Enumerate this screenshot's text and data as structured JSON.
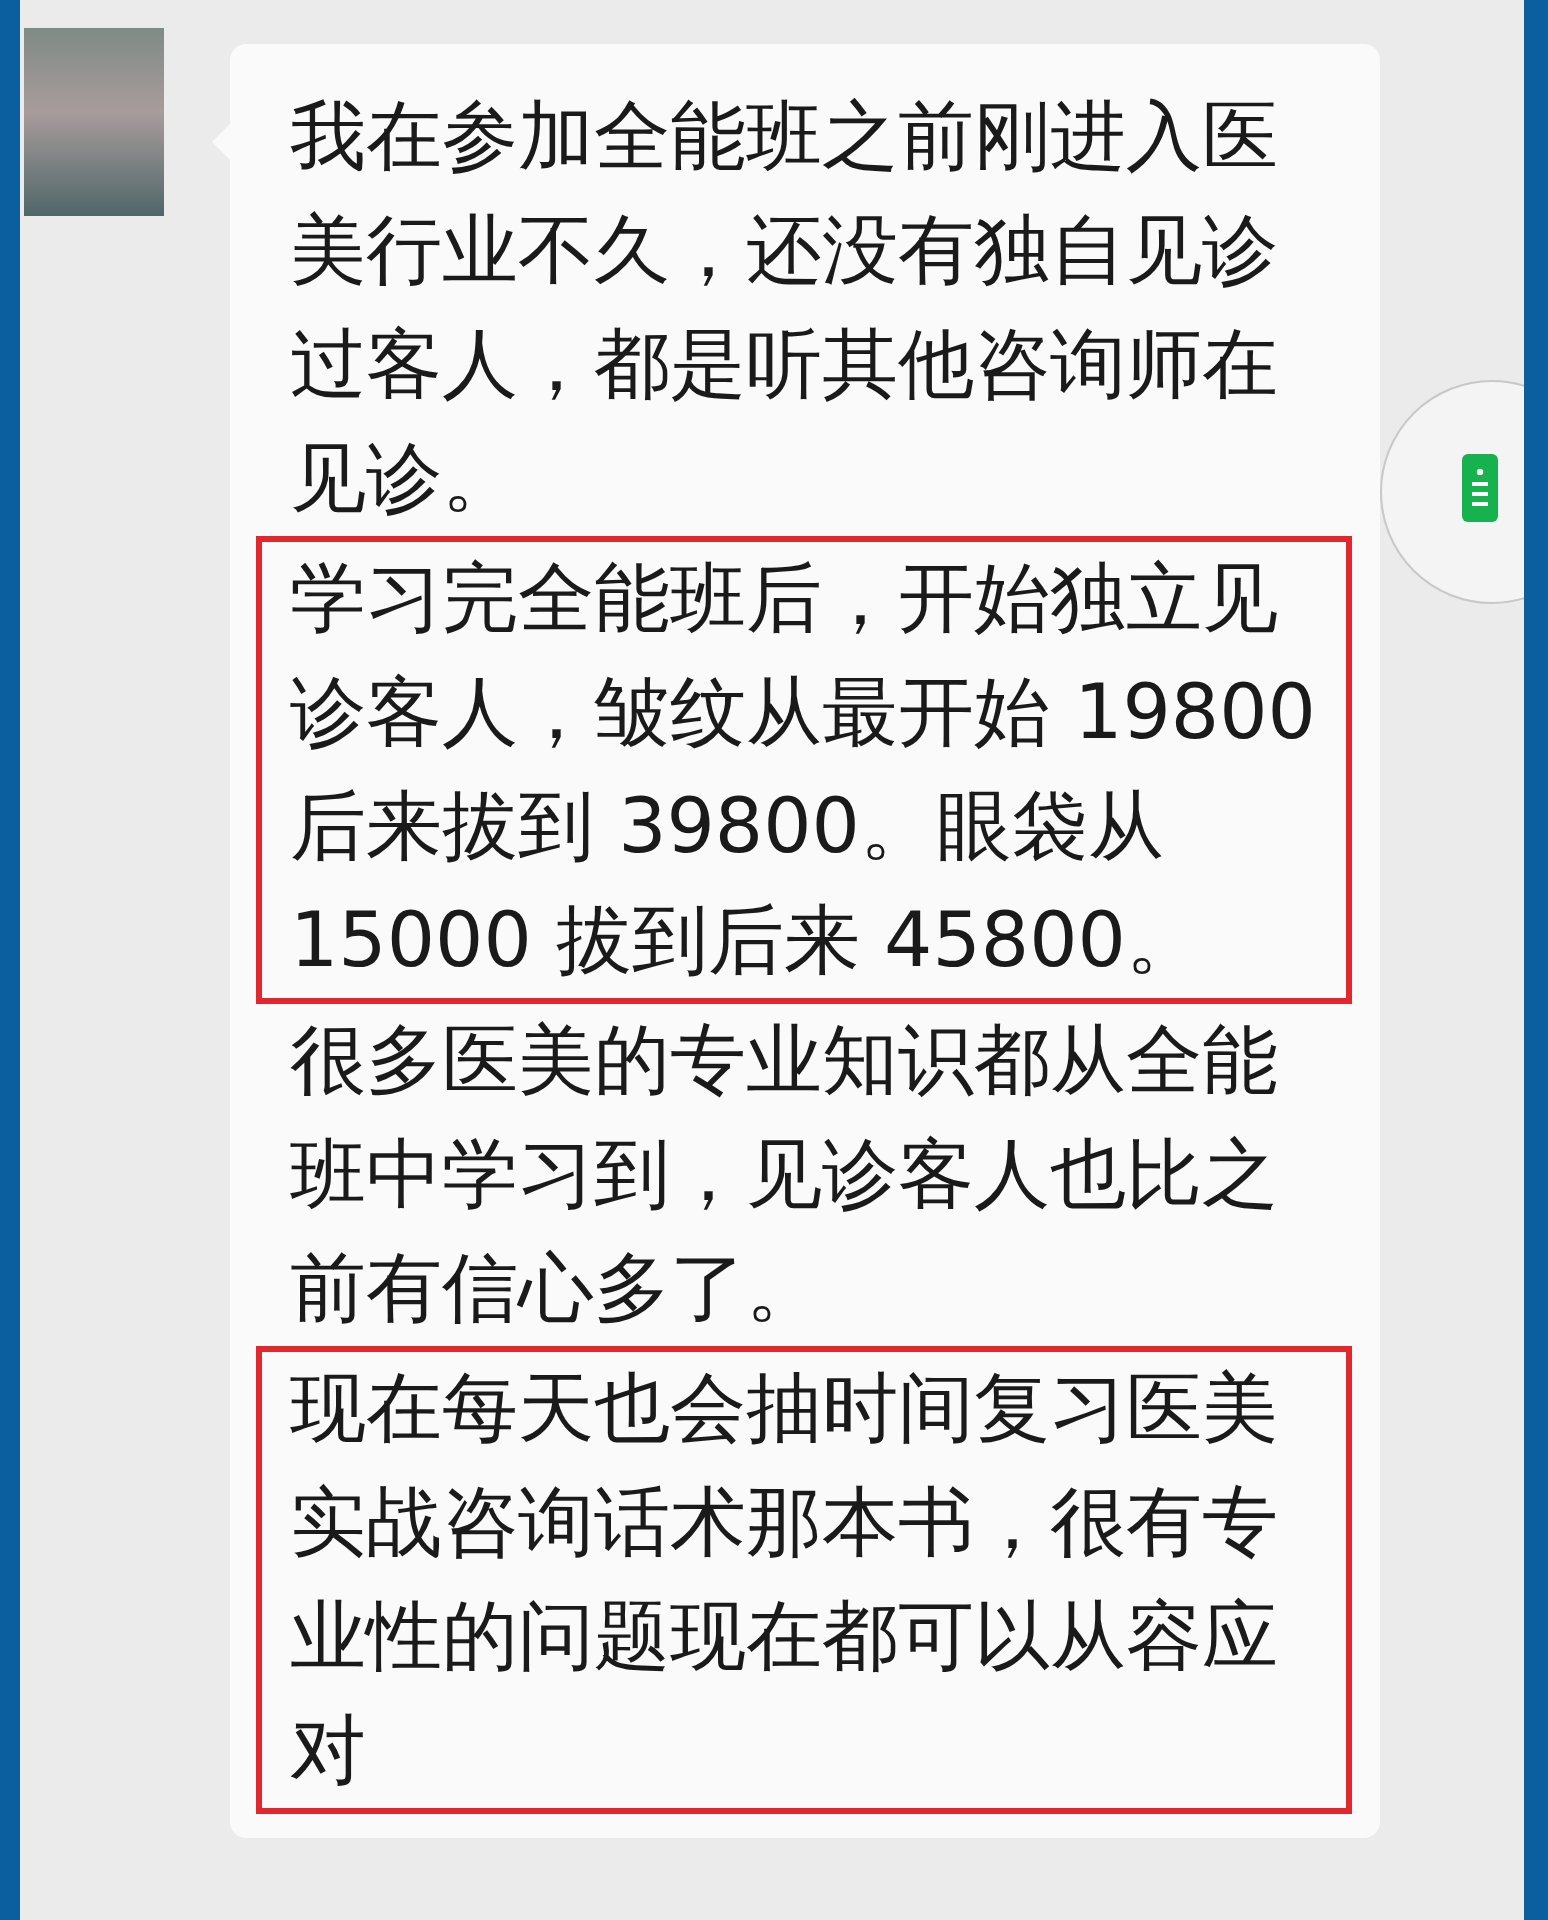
{
  "message": {
    "paragraphs": [
      {
        "highlighted": false,
        "lines": [
          "我在参加全能班之前刚进入医",
          "美行业不久，还没有独自见诊",
          "过客人，都是听其他咨询师在",
          "见诊。"
        ]
      },
      {
        "highlighted": true,
        "lines": [
          "学习完全能班后，开始独立见",
          "诊客人，皱纹从最开始 19800",
          "后来拔到 39800。眼袋从",
          "15000 拔到后来 45800。"
        ]
      },
      {
        "highlighted": false,
        "lines": [
          "很多医美的专业知识都从全能",
          "班中学习到，见诊客人也比之",
          "前有信心多了。"
        ]
      },
      {
        "highlighted": true,
        "lines": [
          "现在每天也会抽时间复习医美",
          "实战咨询话术那本书，很有专",
          "业性的问题现在都可以从容应",
          "对"
        ]
      }
    ]
  }
}
